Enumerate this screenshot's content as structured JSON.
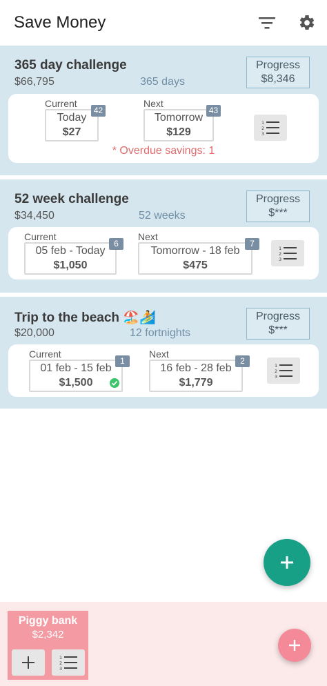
{
  "appbar": {
    "title": "Save Money",
    "filter_icon": "filter-list-icon",
    "settings_icon": "gear-icon"
  },
  "challenges": [
    {
      "title": "365 day challenge",
      "amount": "$66,795",
      "period": "365 days",
      "progress_label": "Progress",
      "progress_value": "$8,346",
      "current_label": "Current",
      "current_date": "Today",
      "current_amount": "$27",
      "current_badge": "42",
      "next_label": "Next",
      "next_date": "Tomorrow",
      "next_amount": "$129",
      "next_badge": "43",
      "notice": "* Overdue savings: 1"
    },
    {
      "title": "52 week challenge",
      "amount": "$34,450",
      "period": "52 weeks",
      "progress_label": "Progress",
      "progress_value": "$***",
      "current_label": "Current",
      "current_date": "05 feb - Today",
      "current_amount": "$1,050",
      "current_badge": "6",
      "next_label": "Next",
      "next_date": "Tomorrow - 18 feb",
      "next_amount": "$475",
      "next_badge": "7"
    },
    {
      "title": "Trip to the beach 🏖️🏄",
      "amount": "$20,000",
      "period": "12 fortnights",
      "progress_label": "Progress",
      "progress_value": "$***",
      "current_label": "Current",
      "current_date": "01 feb - 15 feb",
      "current_amount": "$1,500",
      "current_badge": "1",
      "next_label": "Next",
      "next_date": "16 feb - 28 feb",
      "next_amount": "$1,779",
      "next_badge": "2"
    }
  ],
  "piggy_bank": {
    "title": "Piggy bank",
    "amount": "$2,342",
    "add_icon": "plus-icon",
    "list_icon": "numbered-list-icon"
  },
  "colors": {
    "card_bg": "#d6e6ee",
    "fab_green": "#18a087",
    "fab_pink": "#f48a98",
    "overdue_red": "#e06b6b",
    "badge": "#7a8ea3",
    "footer_bg": "#fce9ea",
    "piggy_bg": "#f49aa3"
  }
}
